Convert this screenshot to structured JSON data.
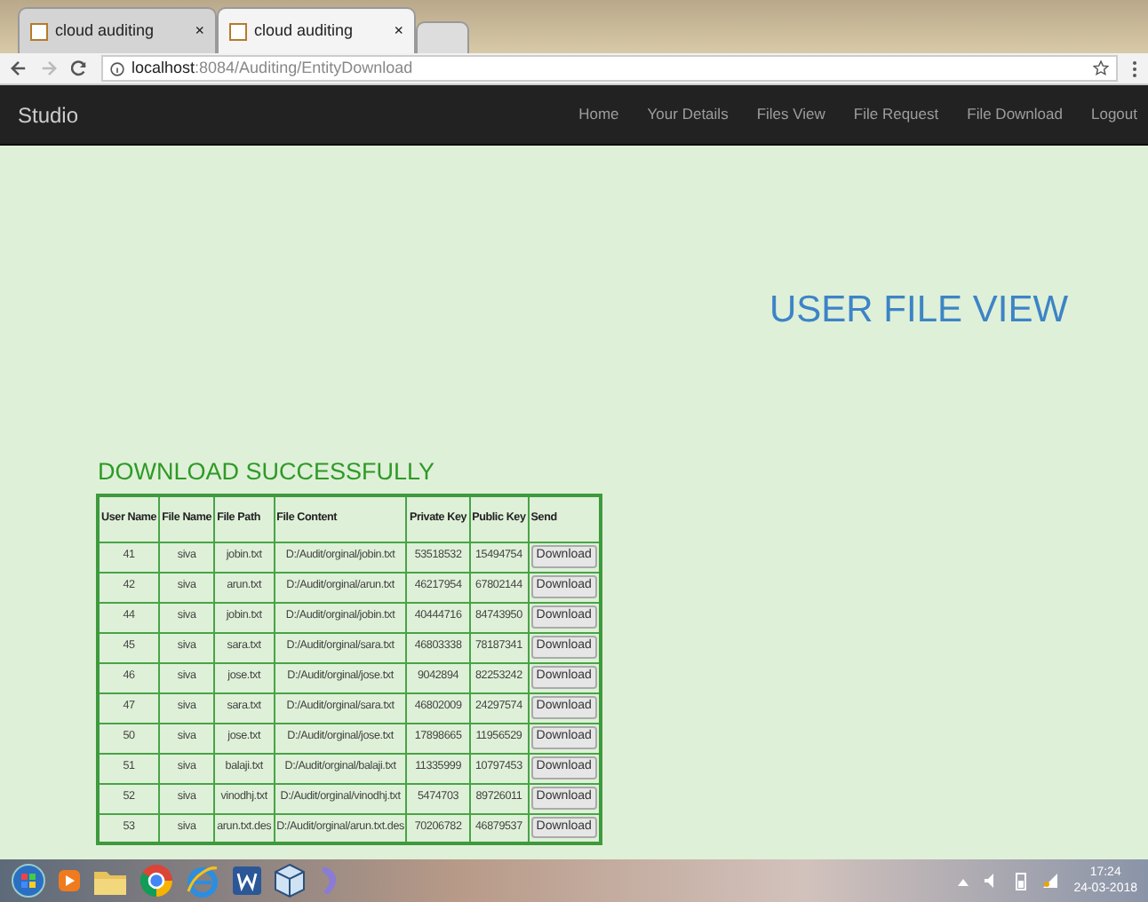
{
  "browser": {
    "tabs": [
      {
        "title": "cloud auditing",
        "close": "×",
        "selected": false
      },
      {
        "title": "cloud auditing",
        "close": "×",
        "selected": true
      }
    ],
    "address": {
      "host": "localhost",
      "rest": ":8084/Auditing/EntityDownload"
    }
  },
  "navbar": {
    "brand": "Studio",
    "links": [
      "Home",
      "Your Details",
      "Files View",
      "File Request",
      "File Download",
      "Logout"
    ]
  },
  "page": {
    "heading": "USER FILE VIEW",
    "message": "DOWNLOAD SUCCESSFULLY"
  },
  "table": {
    "columns": [
      "User Name",
      "File Name",
      "File Path",
      "File Content",
      "Private Key",
      "Public Key",
      "Send"
    ],
    "rows": [
      [
        "41",
        "siva",
        "jobin.txt",
        "D:/Audit/orginal/jobin.txt",
        "53518532",
        "15494754",
        "Download"
      ],
      [
        "42",
        "siva",
        "arun.txt",
        "D:/Audit/orginal/arun.txt",
        "46217954",
        "67802144",
        "Download"
      ],
      [
        "44",
        "siva",
        "jobin.txt",
        "D:/Audit/orginal/jobin.txt",
        "40444716",
        "84743950",
        "Download"
      ],
      [
        "45",
        "siva",
        "sara.txt",
        "D:/Audit/orginal/sara.txt",
        "46803338",
        "78187341",
        "Download"
      ],
      [
        "46",
        "siva",
        "jose.txt",
        "D:/Audit/orginal/jose.txt",
        "9042894",
        "82253242",
        "Download"
      ],
      [
        "47",
        "siva",
        "sara.txt",
        "D:/Audit/orginal/sara.txt",
        "46802009",
        "24297574",
        "Download"
      ],
      [
        "50",
        "siva",
        "jose.txt",
        "D:/Audit/orginal/jose.txt",
        "17898665",
        "11956529",
        "Download"
      ],
      [
        "51",
        "siva",
        "balaji.txt",
        "D:/Audit/orginal/balaji.txt",
        "11335999",
        "10797453",
        "Download"
      ],
      [
        "52",
        "siva",
        "vinodhj.txt",
        "D:/Audit/orginal/vinodhj.txt",
        "5474703",
        "89726011",
        "Download"
      ],
      [
        "53",
        "siva",
        "arun.txt.des",
        "D:/Audit/orginal/arun.txt.des",
        "70206782",
        "46879537",
        "Download"
      ]
    ]
  },
  "taskbar": {
    "time": "17:24",
    "date": "24-03-2018"
  }
}
